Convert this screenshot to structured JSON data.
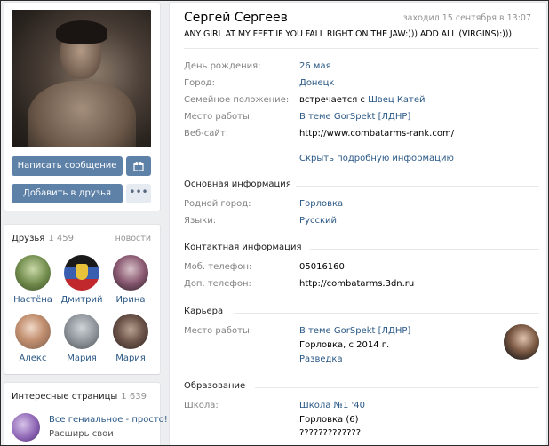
{
  "sidebar": {
    "write_message_label": "Написать сообщение",
    "add_friend_label": "Добавить в друзья",
    "more_label": "•••",
    "friends": {
      "title": "Друзья",
      "count": "1 459",
      "news_link": "новости",
      "items": [
        {
          "name": "Настёна"
        },
        {
          "name": "Дмитрий"
        },
        {
          "name": "Ирина"
        },
        {
          "name": "Алекс"
        },
        {
          "name": "Мария"
        },
        {
          "name": "Мария"
        }
      ]
    },
    "interesting": {
      "title": "Интересные страницы",
      "count": "1 639",
      "item_title": "Все гениальное - просто!",
      "item_subtitle": "Расширь свои"
    }
  },
  "profile": {
    "name": "Сергей Сергеев",
    "last_seen": "заходил 15 сентября в 13:07",
    "status": "ANY GIRL AT MY FEET IF YOU FALL RIGHT ON THE JAW:))) ADD ALL (VIRGINS):)))",
    "short_info": [
      {
        "label": "День рождения:",
        "value": "26 мая"
      },
      {
        "label": "Город:",
        "value": "Донецк"
      },
      {
        "label": "Семейное положение:",
        "value_prefix": "встречается с ",
        "value_link": "Швец Катей"
      },
      {
        "label": "Место работы:",
        "value": "В теме GorSpekt [ЛДНР]"
      },
      {
        "label": "Веб-сайт:",
        "value": "http://www.combatarms-rank.com/"
      }
    ],
    "hide_info_link": "Скрыть подробную информацию",
    "main_info": {
      "title": "Основная информация",
      "rows": [
        {
          "label": "Родной город:",
          "value": "Горловка"
        },
        {
          "label": "Языки:",
          "value": "Русский"
        }
      ]
    },
    "contacts": {
      "title": "Контактная информация",
      "rows": [
        {
          "label": "Моб. телефон:",
          "value": "05016160"
        },
        {
          "label": "Доп. телефон:",
          "value": "http://combatarms.3dn.ru"
        }
      ]
    },
    "career": {
      "title": "Карьера",
      "label": "Место работы:",
      "company": "В теме GorSpekt [ЛДНР]",
      "city_years": "Горловка, с 2014 г.",
      "position": "Разведка"
    },
    "education": {
      "title": "Образование",
      "label": "Школа:",
      "school": "Школа №1 '40",
      "city": "Горловка (6)",
      "extra": "?????????????"
    }
  },
  "colors": {
    "accent": "#5e81a8",
    "link": "#2a5885",
    "label": "#828282",
    "background": "#edeef0"
  }
}
